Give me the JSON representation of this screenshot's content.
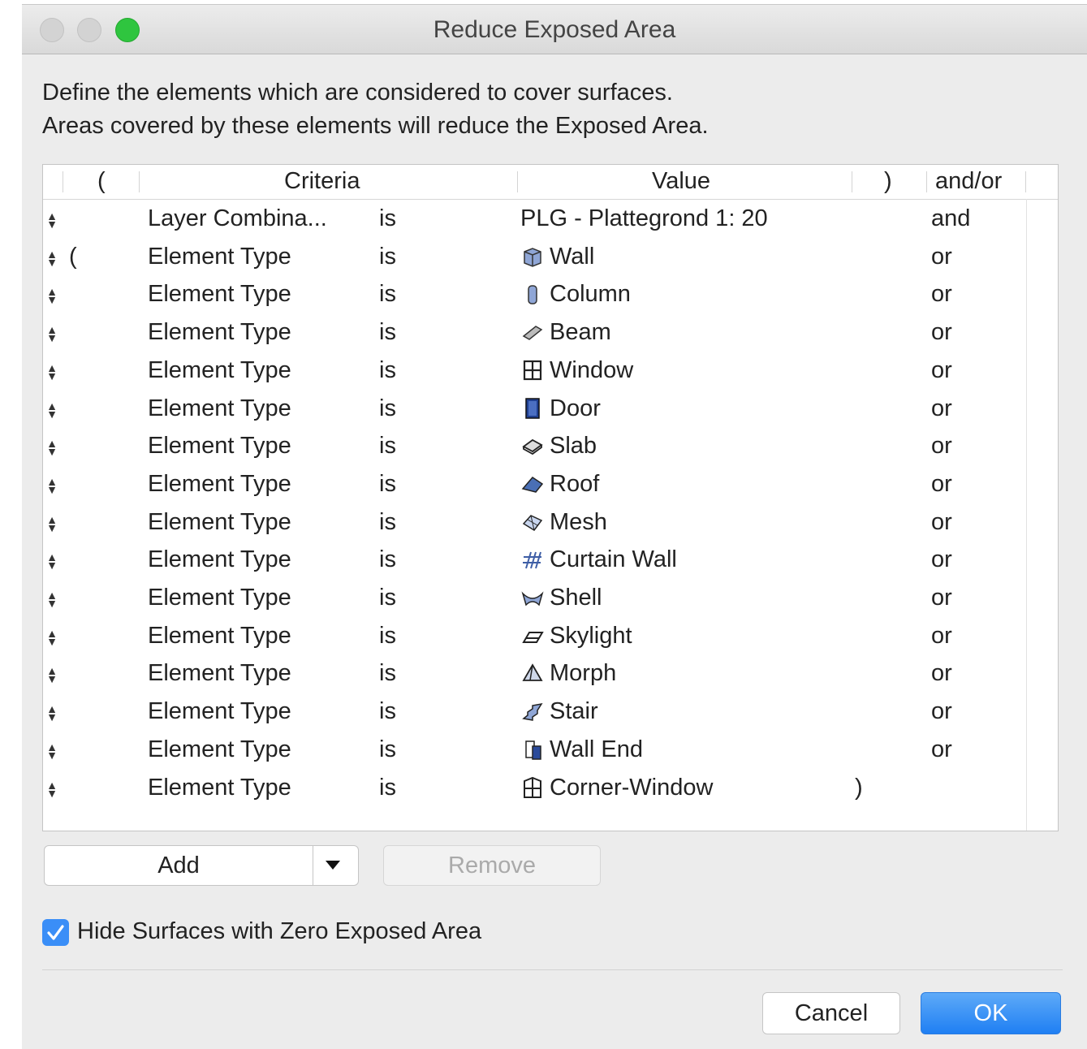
{
  "window": {
    "title": "Reduce Exposed Area",
    "description_line1": "Define the elements which are considered to cover surfaces.",
    "description_line2": "Areas covered by these elements will reduce the Exposed Area."
  },
  "table": {
    "headers": {
      "open_paren": "(",
      "criteria": "Criteria",
      "value": "Value",
      "close_paren": ")",
      "andor": "and/or"
    },
    "rows": [
      {
        "open": "",
        "criteria": "Layer Combina...",
        "op": "is",
        "icon": "",
        "value": "PLG - Plattegrond 1: 20",
        "close": "",
        "andor": "and"
      },
      {
        "open": "(",
        "criteria": "Element Type",
        "op": "is",
        "icon": "wall-icon",
        "value": "Wall",
        "close": "",
        "andor": "or"
      },
      {
        "open": "",
        "criteria": "Element Type",
        "op": "is",
        "icon": "column-icon",
        "value": "Column",
        "close": "",
        "andor": "or"
      },
      {
        "open": "",
        "criteria": "Element Type",
        "op": "is",
        "icon": "beam-icon",
        "value": "Beam",
        "close": "",
        "andor": "or"
      },
      {
        "open": "",
        "criteria": "Element Type",
        "op": "is",
        "icon": "window-icon",
        "value": "Window",
        "close": "",
        "andor": "or"
      },
      {
        "open": "",
        "criteria": "Element Type",
        "op": "is",
        "icon": "door-icon",
        "value": "Door",
        "close": "",
        "andor": "or"
      },
      {
        "open": "",
        "criteria": "Element Type",
        "op": "is",
        "icon": "slab-icon",
        "value": "Slab",
        "close": "",
        "andor": "or"
      },
      {
        "open": "",
        "criteria": "Element Type",
        "op": "is",
        "icon": "roof-icon",
        "value": "Roof",
        "close": "",
        "andor": "or"
      },
      {
        "open": "",
        "criteria": "Element Type",
        "op": "is",
        "icon": "mesh-icon",
        "value": "Mesh",
        "close": "",
        "andor": "or"
      },
      {
        "open": "",
        "criteria": "Element Type",
        "op": "is",
        "icon": "curtain-wall-icon",
        "value": "Curtain Wall",
        "close": "",
        "andor": "or"
      },
      {
        "open": "",
        "criteria": "Element Type",
        "op": "is",
        "icon": "shell-icon",
        "value": "Shell",
        "close": "",
        "andor": "or"
      },
      {
        "open": "",
        "criteria": "Element Type",
        "op": "is",
        "icon": "skylight-icon",
        "value": "Skylight",
        "close": "",
        "andor": "or"
      },
      {
        "open": "",
        "criteria": "Element Type",
        "op": "is",
        "icon": "morph-icon",
        "value": "Morph",
        "close": "",
        "andor": "or"
      },
      {
        "open": "",
        "criteria": "Element Type",
        "op": "is",
        "icon": "stair-icon",
        "value": "Stair",
        "close": "",
        "andor": "or"
      },
      {
        "open": "",
        "criteria": "Element Type",
        "op": "is",
        "icon": "wall-end-icon",
        "value": "Wall End",
        "close": "",
        "andor": "or"
      },
      {
        "open": "",
        "criteria": "Element Type",
        "op": "is",
        "icon": "corner-window-icon",
        "value": "Corner-Window",
        "close": ")",
        "andor": ""
      }
    ]
  },
  "buttons": {
    "add": "Add",
    "remove": "Remove",
    "cancel": "Cancel",
    "ok": "OK"
  },
  "options": {
    "hide_zero_label": "Hide Surfaces with Zero Exposed Area",
    "hide_zero_checked": true
  },
  "colors": {
    "accent": "#3a8ef7",
    "close_button": "#2fc53f"
  }
}
